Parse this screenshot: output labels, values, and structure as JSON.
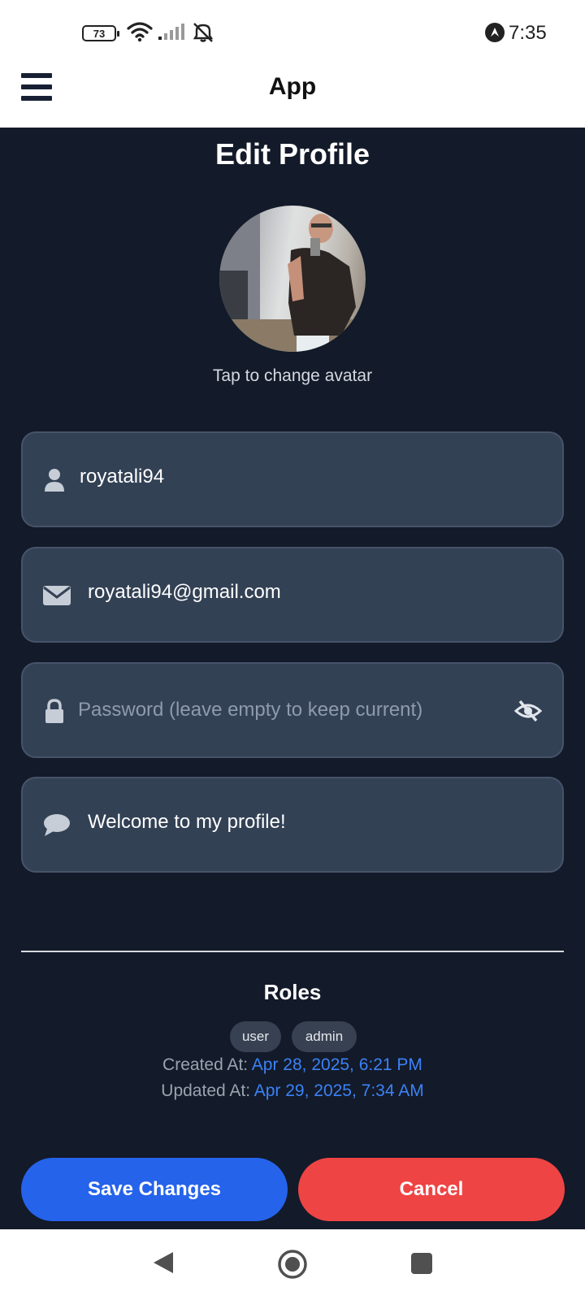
{
  "status_bar": {
    "battery": "73",
    "time": "7:35",
    "icons": [
      "wifi-icon",
      "signal-icon",
      "mute-icon",
      "nav-status-icon"
    ]
  },
  "header": {
    "title": "App",
    "menu_icon": "hamburger-menu-icon"
  },
  "profile": {
    "page_title": "Edit Profile",
    "avatar_hint": "Tap to change avatar",
    "fields": {
      "username": {
        "icon": "user-icon",
        "value": "royatali94"
      },
      "email": {
        "icon": "envelope-icon",
        "value": "royatali94@gmail.com"
      },
      "password": {
        "icon": "lock-icon",
        "placeholder": "Password (leave empty to keep current)",
        "toggle_icon": "eye-slash-icon"
      },
      "bio": {
        "icon": "speech-bubble-icon",
        "value": "Welcome to my profile!"
      }
    },
    "roles_title": "Roles",
    "roles": [
      "user",
      "admin"
    ],
    "created_label": "Created At: ",
    "created_value": "Apr 28, 2025, 6:21 PM",
    "updated_label": "Updated At: ",
    "updated_value": "Apr 29, 2025, 7:34 AM"
  },
  "actions": {
    "save_label": "Save Changes",
    "cancel_label": "Cancel"
  },
  "colors": {
    "background": "#131a29",
    "field": "#334155",
    "primary": "#2563eb",
    "danger": "#ef4444",
    "accent_text": "#3b82f6"
  },
  "nav_bar": {
    "icons": [
      "back-icon",
      "home-icon",
      "recents-icon"
    ]
  }
}
